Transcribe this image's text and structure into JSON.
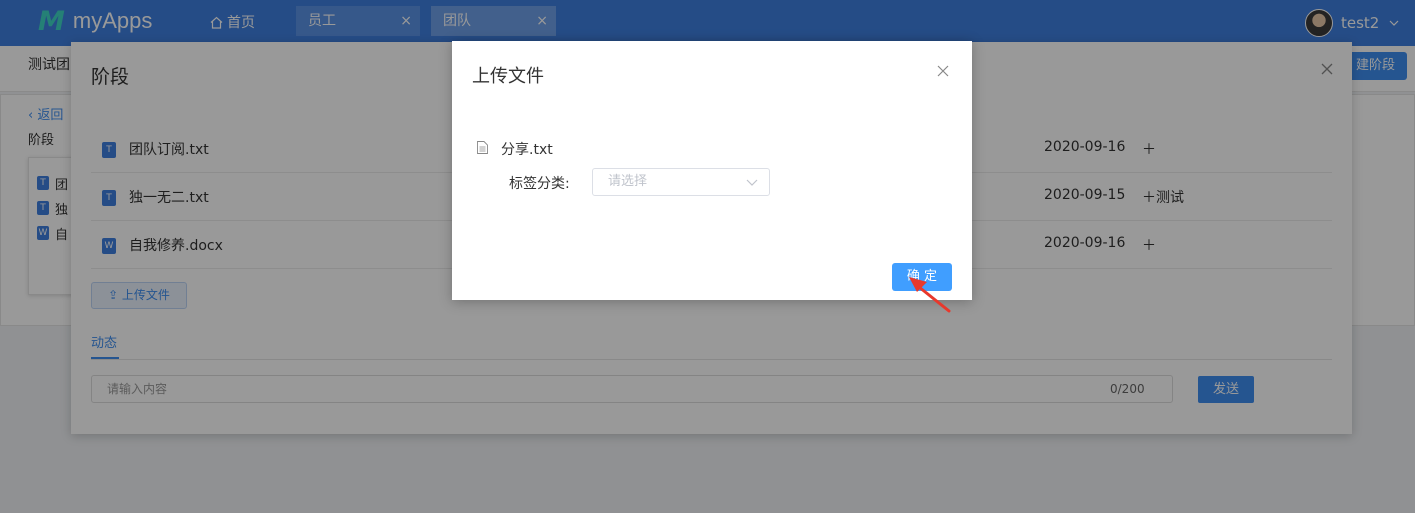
{
  "header": {
    "logo_mark": "M",
    "logo_text": "myApps",
    "home_label": "首页",
    "tabs": [
      {
        "label": "员工",
        "close": "×"
      },
      {
        "label": "团队",
        "close": "×"
      }
    ],
    "user_name": "test2",
    "home_icon": "home-icon",
    "colors": {
      "bar": "#3f7fdf",
      "logo_accent": "#3fd6c5"
    }
  },
  "page": {
    "title": "测试团",
    "new_stage_label": "建阶段",
    "back_label": "‹ 返回",
    "stage_label": "阶段",
    "mini_items": [
      {
        "icon": "T",
        "label": "团"
      },
      {
        "icon": "T",
        "label": "独"
      },
      {
        "icon": "W",
        "label": "自"
      }
    ]
  },
  "panel": {
    "title": "阶段",
    "files": [
      {
        "icon": "T",
        "name": "团队订阅.txt",
        "date": "2020-09-16",
        "tag": "＋"
      },
      {
        "icon": "T",
        "name": "独一无二.txt",
        "date": "2020-09-15",
        "tag": "＋测试"
      },
      {
        "icon": "W",
        "name": "自我修养.docx",
        "date": "2020-09-16",
        "tag": "＋"
      }
    ],
    "upload_label": "⇪ 上传文件",
    "activity_tab": "动态",
    "comment_placeholder": "请输入内容",
    "comment_count": "0/200",
    "send_label": "发送"
  },
  "dialog": {
    "title": "上传文件",
    "file_name": "分享.txt",
    "tag_label": "标签分类:",
    "tag_placeholder": "请选择",
    "ok_label": "确 定",
    "colors": {
      "primary": "#409eff",
      "annotation": "#e8382c"
    }
  }
}
